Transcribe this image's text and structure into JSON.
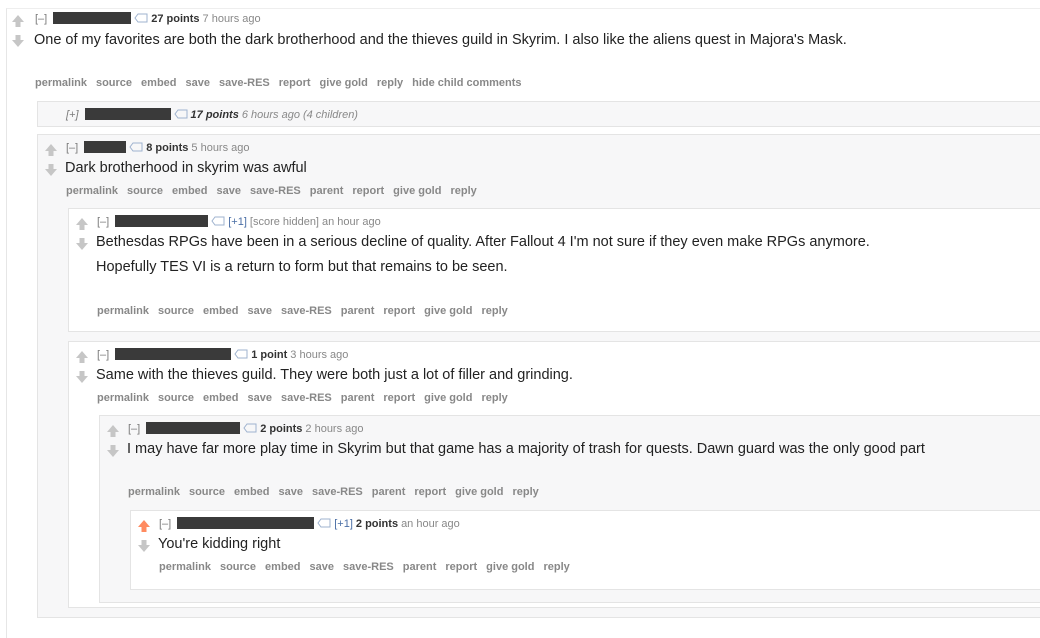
{
  "icons": {
    "upvote": "up-arrow-icon",
    "upvote_active": "up-arrow-orange-icon",
    "downvote": "down-arrow-icon",
    "tag": "user-tag-icon"
  },
  "colors": {
    "upvoted": "#ff8b60",
    "arrow": "#c6c6c6",
    "link": "#888888"
  },
  "comments": [
    {
      "expand": "[–]",
      "points": "27 points",
      "time": "7 hours ago",
      "paragraphs": [
        "One of my favorites are both the dark brotherhood and the thieves guild in Skyrim. I also like the aliens quest in Majora's Mask."
      ],
      "buttons": [
        "permalink",
        "source",
        "embed",
        "save",
        "save-RES",
        "report",
        "give gold",
        "reply",
        "hide child comments"
      ]
    },
    {
      "expand": "[+]",
      "points": "17 points",
      "time": "6 hours ago",
      "children": "(4 children)"
    },
    {
      "expand": "[–]",
      "points": "8 points",
      "time": "5 hours ago",
      "paragraphs": [
        "Dark brotherhood in skyrim was awful"
      ],
      "buttons": [
        "permalink",
        "source",
        "embed",
        "save",
        "save-RES",
        "parent",
        "report",
        "give gold",
        "reply"
      ]
    },
    {
      "expand": "[–]",
      "plus_one": "[+1]",
      "score_hidden": "[score hidden]",
      "time": "an hour ago",
      "paragraphs": [
        "Bethesdas RPGs have been in a serious decline of quality. After Fallout 4 I'm not sure if they even make RPGs anymore.",
        "Hopefully TES VI is a return to form but that remains to be seen."
      ],
      "buttons": [
        "permalink",
        "source",
        "embed",
        "save",
        "save-RES",
        "parent",
        "report",
        "give gold",
        "reply"
      ]
    },
    {
      "expand": "[–]",
      "points": "1 point",
      "time": "3 hours ago",
      "paragraphs": [
        "Same with the thieves guild. They were both just a lot of filler and grinding."
      ],
      "buttons": [
        "permalink",
        "source",
        "embed",
        "save",
        "save-RES",
        "parent",
        "report",
        "give gold",
        "reply"
      ]
    },
    {
      "expand": "[–]",
      "points": "2 points",
      "time": "2 hours ago",
      "paragraphs": [
        "I may have far more play time in Skyrim but that game has a majority of trash for quests. Dawn guard was the only good part"
      ],
      "buttons": [
        "permalink",
        "source",
        "embed",
        "save",
        "save-RES",
        "parent",
        "report",
        "give gold",
        "reply"
      ]
    },
    {
      "expand": "[–]",
      "plus_one": "[+1]",
      "points": "2 points",
      "time": "an hour ago",
      "paragraphs": [
        "You're kidding right"
      ],
      "buttons": [
        "permalink",
        "source",
        "embed",
        "save",
        "save-RES",
        "parent",
        "report",
        "give gold",
        "reply"
      ]
    }
  ]
}
